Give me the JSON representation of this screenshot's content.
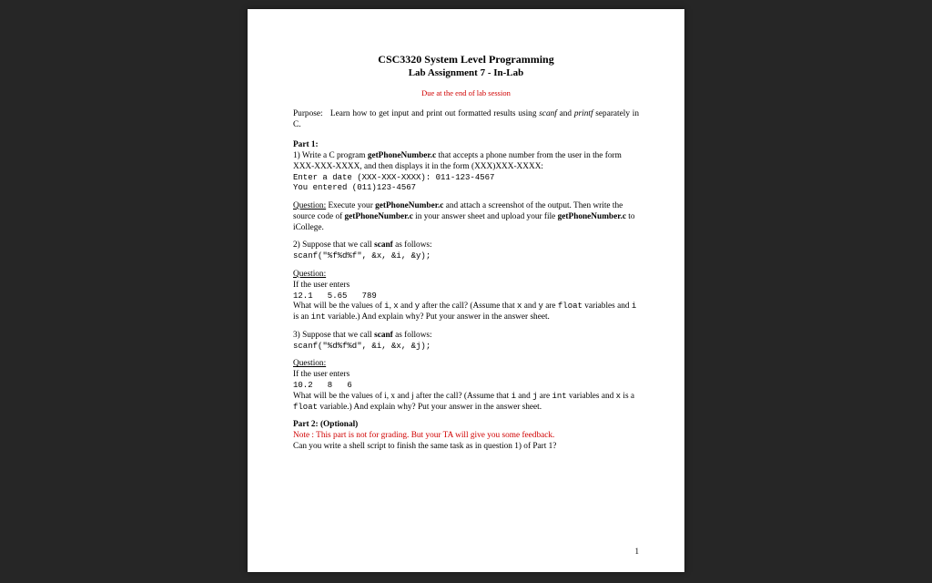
{
  "header": {
    "course_title": "CSC3320 System Level Programming",
    "assignment_title": "Lab Assignment 7 - In-Lab",
    "due_notice": "Due at the end of lab session"
  },
  "purpose": {
    "lead": "Purpose:",
    "text_a": "Learn how to get input and print out formatted results using ",
    "scanf": "scanf",
    "and": " and ",
    "printf": "printf",
    "text_b": " separately in C."
  },
  "part1": {
    "label": "Part 1:",
    "q1_intro_a": "1) Write a C program ",
    "q1_prog": "getPhoneNumber.c",
    "q1_intro_b": " that accepts a phone number from the user in the form XXX-XXX-XXXX, and then displays it in the form (XXX)XXX-XXXX:",
    "q1_code1": "Enter a date (XXX-XXX-XXXX): 011-123-4567",
    "q1_code2": "You entered (011)123-4567",
    "q1_ques_label": "Question:",
    "q1_ques_a": " Execute your ",
    "q1_ques_prog1": "getPhoneNumber.c",
    "q1_ques_b": " and attach a screenshot of the output. Then write the source code of ",
    "q1_ques_prog2": "getPhoneNumber.c",
    "q1_ques_c": " in your answer sheet and upload your file ",
    "q1_ques_prog3": "getPhoneNumber.c",
    "q1_ques_d": " to iCollege.",
    "q2_intro_a": "2)  Suppose that we call ",
    "q2_scanf": "scanf",
    "q2_intro_b": " as follows:",
    "q2_code": "scanf(\"%f%d%f\", &x, &i, &y);",
    "q2_ques_label": "Question:",
    "q2_if": "If the user enters",
    "q2_input": "12.1   5.65   789",
    "q2_body_a": "What will be the values of ",
    "q2_i": "i",
    "q2_body_b": ", ",
    "q2_x": "x",
    "q2_body_c": " and ",
    "q2_y": "y",
    "q2_body_d": " after the call? (Assume that ",
    "q2_x2": "x",
    "q2_body_e": "  and ",
    "q2_y2": "y",
    "q2_body_f": "  are ",
    "q2_float": "float",
    "q2_body_g": " variables and ",
    "q2_i2": "i",
    "q2_body_h": "  is an ",
    "q2_int": "int",
    "q2_body_i": "  variable.) And explain why? Put your answer in the answer sheet.",
    "q3_intro_a": "3)  Suppose that we call ",
    "q3_scanf": "scanf",
    "q3_intro_b": " as follows:",
    "q3_code": "scanf(\"%d%f%d\", &i, &x, &j);",
    "q3_ques_label": "Question:",
    "q3_if": "If the user enters",
    "q3_input": "10.2   8   6",
    "q3_body_a": "What will be the values of i, x and j after the call? (Assume that ",
    "q3_i": "i",
    "q3_body_b": "  and ",
    "q3_j": "j",
    "q3_body_c": "  are ",
    "q3_int": "int",
    "q3_body_d": "  variables and ",
    "q3_x": "x",
    "q3_body_e": "  is a ",
    "q3_float": "float",
    "q3_body_f": "  variable.) And explain why? Put your answer in the answer sheet."
  },
  "part2": {
    "label": "Part 2: (Optional)",
    "note": "Note : This part is not for grading. But your TA will give you some feedback.",
    "body": "Can you write a shell script to finish the same task as in question 1) of Part 1?"
  },
  "page_number": "1"
}
